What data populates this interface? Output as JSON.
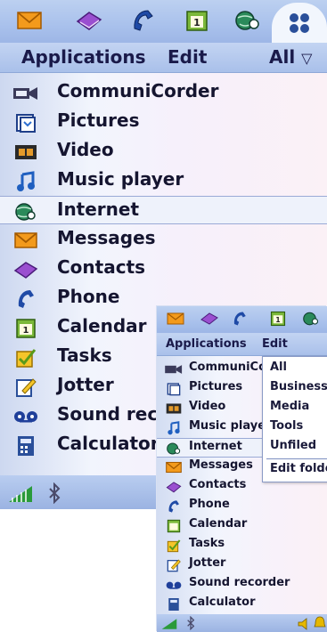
{
  "main": {
    "menu": {
      "applications": "Applications",
      "edit": "Edit",
      "filter": "All",
      "filter_arrow": "▽"
    },
    "app_bar_icons": [
      "messages-icon",
      "contacts-icon",
      "phone-icon",
      "calendar-icon",
      "internet-icon",
      "applications-grid-icon"
    ],
    "items": [
      {
        "label": "CommuniCorder",
        "icon": "video-camera-icon"
      },
      {
        "label": "Pictures",
        "icon": "pictures-icon"
      },
      {
        "label": "Video",
        "icon": "film-icon"
      },
      {
        "label": "Music player",
        "icon": "music-note-icon"
      },
      {
        "label": "Internet",
        "icon": "globe-icon",
        "selected": true
      },
      {
        "label": "Messages",
        "icon": "envelope-icon"
      },
      {
        "label": "Contacts",
        "icon": "contacts-book-icon"
      },
      {
        "label": "Phone",
        "icon": "phone-handset-icon"
      },
      {
        "label": "Calendar",
        "icon": "calendar-icon"
      },
      {
        "label": "Tasks",
        "icon": "checkbox-icon"
      },
      {
        "label": "Jotter",
        "icon": "notepad-icon"
      },
      {
        "label": "Sound recorder",
        "icon": "tape-icon"
      },
      {
        "label": "Calculator",
        "icon": "calculator-icon"
      }
    ]
  },
  "inset": {
    "menu": {
      "applications": "Applications",
      "edit": "Edit"
    },
    "items": [
      {
        "label": "CommuniCorder",
        "icon": "video-camera-icon"
      },
      {
        "label": "Pictures",
        "icon": "pictures-icon"
      },
      {
        "label": "Video",
        "icon": "film-icon"
      },
      {
        "label": "Music player",
        "icon": "music-note-icon"
      },
      {
        "label": "Internet",
        "icon": "globe-icon",
        "selected": true
      },
      {
        "label": "Messages",
        "icon": "envelope-icon"
      },
      {
        "label": "Contacts",
        "icon": "contacts-book-icon"
      },
      {
        "label": "Phone",
        "icon": "phone-handset-icon"
      },
      {
        "label": "Calendar",
        "icon": "calendar-icon"
      },
      {
        "label": "Tasks",
        "icon": "checkbox-icon"
      },
      {
        "label": "Jotter",
        "icon": "notepad-icon"
      },
      {
        "label": "Sound recorder",
        "icon": "tape-icon"
      },
      {
        "label": "Calculator",
        "icon": "calculator-icon"
      }
    ],
    "dropdown": {
      "items": [
        "All",
        "Business",
        "Media",
        "Tools",
        "Unfiled"
      ],
      "action": "Edit folders"
    }
  },
  "colors": {
    "bar_blue": "#a9c1ec",
    "text_dark": "#151530",
    "highlight": "#eef2fb"
  }
}
